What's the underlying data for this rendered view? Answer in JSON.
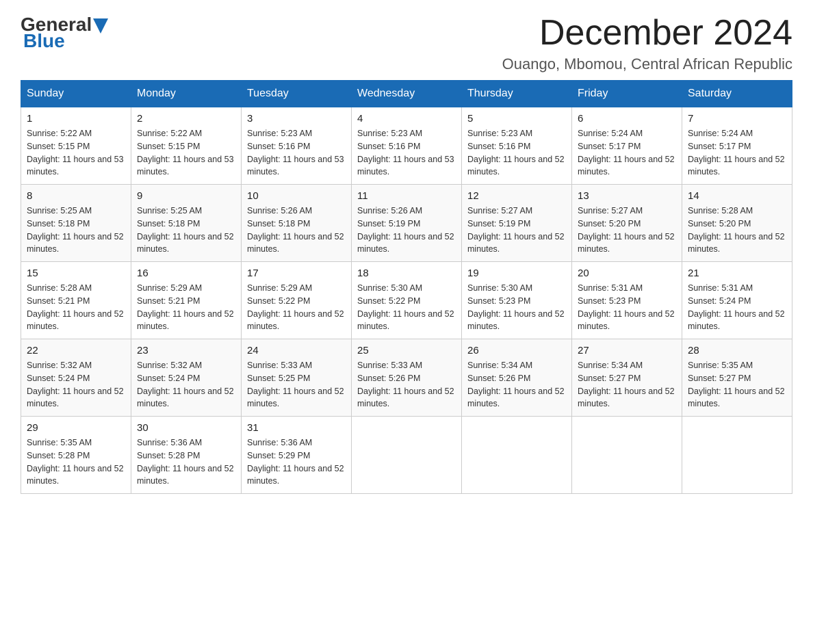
{
  "header": {
    "logo_general": "General",
    "logo_blue": "Blue",
    "month_title": "December 2024",
    "location": "Ouango, Mbomou, Central African Republic"
  },
  "weekdays": [
    "Sunday",
    "Monday",
    "Tuesday",
    "Wednesday",
    "Thursday",
    "Friday",
    "Saturday"
  ],
  "weeks": [
    [
      {
        "day": "1",
        "sunrise": "5:22 AM",
        "sunset": "5:15 PM",
        "daylight": "11 hours and 53 minutes."
      },
      {
        "day": "2",
        "sunrise": "5:22 AM",
        "sunset": "5:15 PM",
        "daylight": "11 hours and 53 minutes."
      },
      {
        "day": "3",
        "sunrise": "5:23 AM",
        "sunset": "5:16 PM",
        "daylight": "11 hours and 53 minutes."
      },
      {
        "day": "4",
        "sunrise": "5:23 AM",
        "sunset": "5:16 PM",
        "daylight": "11 hours and 53 minutes."
      },
      {
        "day": "5",
        "sunrise": "5:23 AM",
        "sunset": "5:16 PM",
        "daylight": "11 hours and 52 minutes."
      },
      {
        "day": "6",
        "sunrise": "5:24 AM",
        "sunset": "5:17 PM",
        "daylight": "11 hours and 52 minutes."
      },
      {
        "day": "7",
        "sunrise": "5:24 AM",
        "sunset": "5:17 PM",
        "daylight": "11 hours and 52 minutes."
      }
    ],
    [
      {
        "day": "8",
        "sunrise": "5:25 AM",
        "sunset": "5:18 PM",
        "daylight": "11 hours and 52 minutes."
      },
      {
        "day": "9",
        "sunrise": "5:25 AM",
        "sunset": "5:18 PM",
        "daylight": "11 hours and 52 minutes."
      },
      {
        "day": "10",
        "sunrise": "5:26 AM",
        "sunset": "5:18 PM",
        "daylight": "11 hours and 52 minutes."
      },
      {
        "day": "11",
        "sunrise": "5:26 AM",
        "sunset": "5:19 PM",
        "daylight": "11 hours and 52 minutes."
      },
      {
        "day": "12",
        "sunrise": "5:27 AM",
        "sunset": "5:19 PM",
        "daylight": "11 hours and 52 minutes."
      },
      {
        "day": "13",
        "sunrise": "5:27 AM",
        "sunset": "5:20 PM",
        "daylight": "11 hours and 52 minutes."
      },
      {
        "day": "14",
        "sunrise": "5:28 AM",
        "sunset": "5:20 PM",
        "daylight": "11 hours and 52 minutes."
      }
    ],
    [
      {
        "day": "15",
        "sunrise": "5:28 AM",
        "sunset": "5:21 PM",
        "daylight": "11 hours and 52 minutes."
      },
      {
        "day": "16",
        "sunrise": "5:29 AM",
        "sunset": "5:21 PM",
        "daylight": "11 hours and 52 minutes."
      },
      {
        "day": "17",
        "sunrise": "5:29 AM",
        "sunset": "5:22 PM",
        "daylight": "11 hours and 52 minutes."
      },
      {
        "day": "18",
        "sunrise": "5:30 AM",
        "sunset": "5:22 PM",
        "daylight": "11 hours and 52 minutes."
      },
      {
        "day": "19",
        "sunrise": "5:30 AM",
        "sunset": "5:23 PM",
        "daylight": "11 hours and 52 minutes."
      },
      {
        "day": "20",
        "sunrise": "5:31 AM",
        "sunset": "5:23 PM",
        "daylight": "11 hours and 52 minutes."
      },
      {
        "day": "21",
        "sunrise": "5:31 AM",
        "sunset": "5:24 PM",
        "daylight": "11 hours and 52 minutes."
      }
    ],
    [
      {
        "day": "22",
        "sunrise": "5:32 AM",
        "sunset": "5:24 PM",
        "daylight": "11 hours and 52 minutes."
      },
      {
        "day": "23",
        "sunrise": "5:32 AM",
        "sunset": "5:24 PM",
        "daylight": "11 hours and 52 minutes."
      },
      {
        "day": "24",
        "sunrise": "5:33 AM",
        "sunset": "5:25 PM",
        "daylight": "11 hours and 52 minutes."
      },
      {
        "day": "25",
        "sunrise": "5:33 AM",
        "sunset": "5:26 PM",
        "daylight": "11 hours and 52 minutes."
      },
      {
        "day": "26",
        "sunrise": "5:34 AM",
        "sunset": "5:26 PM",
        "daylight": "11 hours and 52 minutes."
      },
      {
        "day": "27",
        "sunrise": "5:34 AM",
        "sunset": "5:27 PM",
        "daylight": "11 hours and 52 minutes."
      },
      {
        "day": "28",
        "sunrise": "5:35 AM",
        "sunset": "5:27 PM",
        "daylight": "11 hours and 52 minutes."
      }
    ],
    [
      {
        "day": "29",
        "sunrise": "5:35 AM",
        "sunset": "5:28 PM",
        "daylight": "11 hours and 52 minutes."
      },
      {
        "day": "30",
        "sunrise": "5:36 AM",
        "sunset": "5:28 PM",
        "daylight": "11 hours and 52 minutes."
      },
      {
        "day": "31",
        "sunrise": "5:36 AM",
        "sunset": "5:29 PM",
        "daylight": "11 hours and 52 minutes."
      },
      null,
      null,
      null,
      null
    ]
  ]
}
